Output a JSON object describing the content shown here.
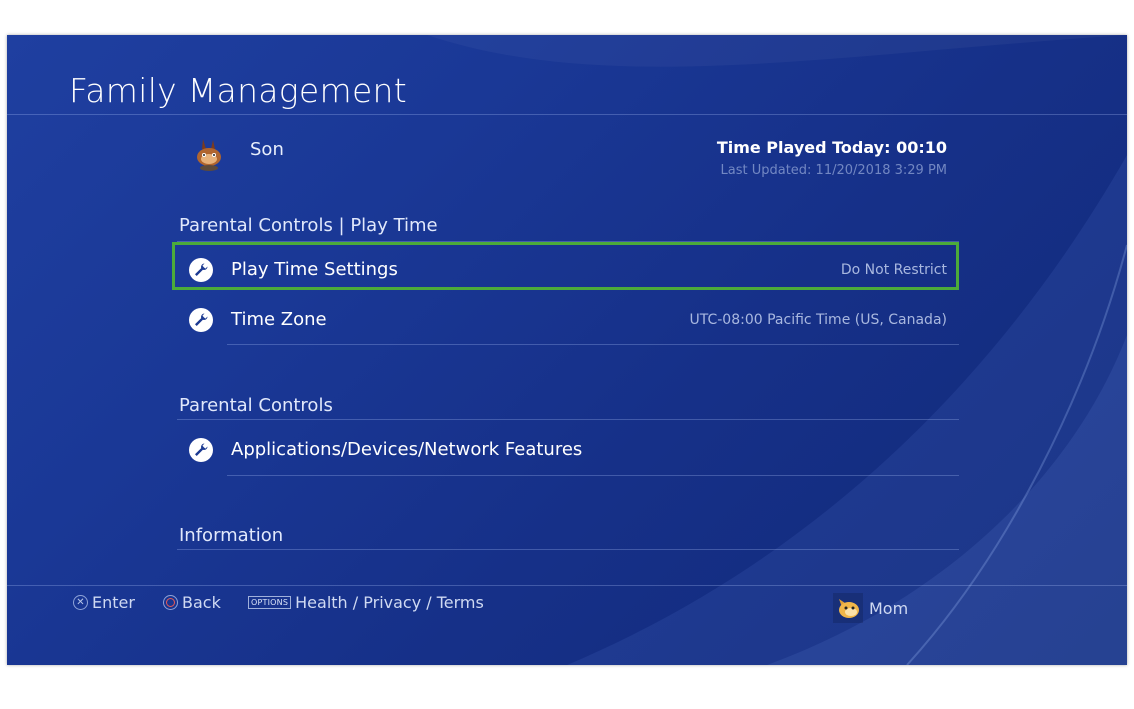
{
  "screen_title": "Family Management",
  "user": {
    "name": "Son",
    "time_played": "Time Played Today: 00:10",
    "last_updated": "Last Updated: 11/20/2018 3:29 PM"
  },
  "sections": {
    "play_time": {
      "header": "Parental Controls | Play Time",
      "rows": [
        {
          "label": "Play Time Settings",
          "value": "Do Not Restrict"
        },
        {
          "label": "Time Zone",
          "value": "UTC-08:00 Pacific Time (US, Canada)"
        }
      ]
    },
    "parental_controls": {
      "header": "Parental Controls",
      "rows": [
        {
          "label": "Applications/Devices/Network Features"
        }
      ]
    },
    "information": {
      "header": "Information"
    }
  },
  "footer": {
    "enter": "Enter",
    "back": "Back",
    "options_badge": "OPTIONS",
    "health": "Health / Privacy / Terms",
    "current_user": "Mom"
  },
  "colors": {
    "background": "#1a3896",
    "highlight": "#4cab3a",
    "text": "#ffffff"
  }
}
